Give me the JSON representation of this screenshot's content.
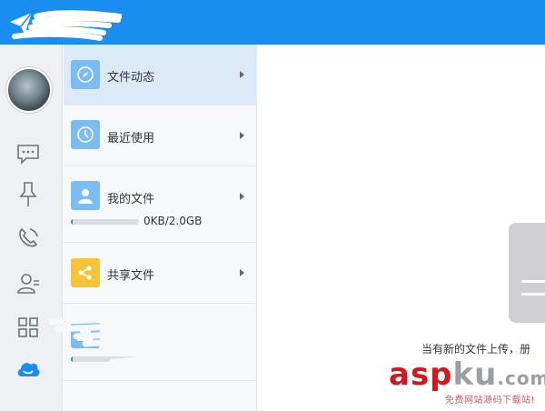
{
  "colors": {
    "accent": "#1a8ef0",
    "active_row": "#dceaf7",
    "icon_blue": "#7bbcf2",
    "icon_yellow": "#f7c338",
    "cloud_blue": "#1a8ef0"
  },
  "top_bar": {
    "logo_icon": "paper-plane-logo-icon"
  },
  "rail": {
    "items": [
      {
        "name": "chat-bubble-icon"
      },
      {
        "name": "pin-icon"
      },
      {
        "name": "phone-icon"
      },
      {
        "name": "contacts-icon"
      },
      {
        "name": "grid-apps-icon"
      },
      {
        "name": "cloud-icon"
      }
    ]
  },
  "menu": {
    "items": [
      {
        "label": "文件动态",
        "icon": "compass-icon"
      },
      {
        "label": "最近使用",
        "icon": "clock-icon"
      },
      {
        "label": "我的文件",
        "icon": "user-icon",
        "quota": "0KB/2.0GB",
        "progress": 0.02
      },
      {
        "label": "共享文件",
        "icon": "share-icon"
      },
      {
        "label": "",
        "icon": "group-icon",
        "progress": 0.02
      }
    ]
  },
  "main": {
    "empty_text": "当有新的文件上传，册"
  },
  "watermark": {
    "asp": "asp",
    "ku": "ku",
    "com": ".com",
    "sub": "免费网站源码下载站!"
  }
}
